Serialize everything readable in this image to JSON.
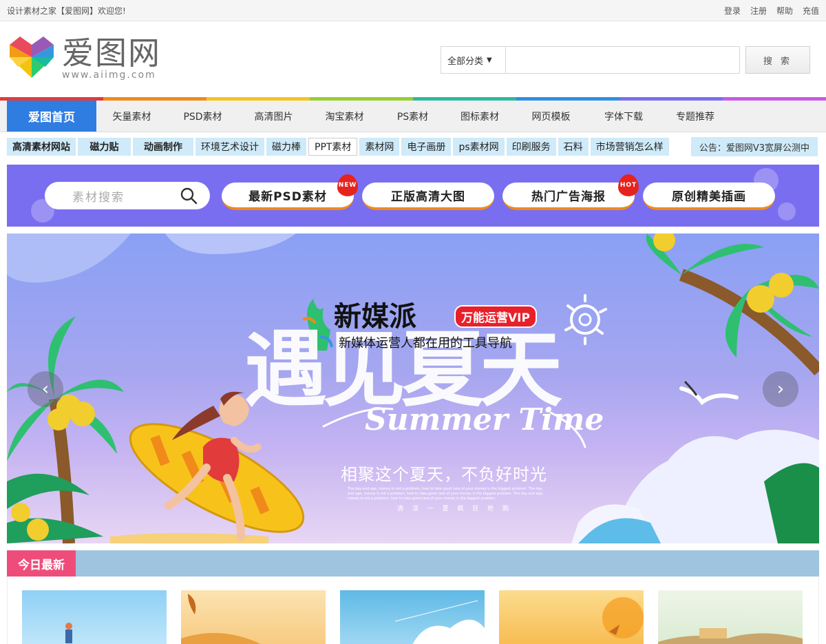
{
  "topbar": {
    "welcome": "设计素材之家【爱图网】欢迎您!",
    "links": [
      "登录",
      "注册",
      "帮助",
      "充值"
    ]
  },
  "logo": {
    "name": "爱图网",
    "domain": "www.aiimg.com"
  },
  "search": {
    "category": "全部分类",
    "placeholder": "",
    "button": "搜 索"
  },
  "rainbow": [
    "#e23b3b",
    "#f08a1a",
    "#f7c31b",
    "#9acd32",
    "#2db9a0",
    "#2f8fe0",
    "#7a6ef0",
    "#c75be0"
  ],
  "nav": {
    "home": "爱图首页",
    "items": [
      "矢量素材",
      "PSD素材",
      "高清图片",
      "淘宝素材",
      "PS素材",
      "图标素材",
      "网页模板",
      "字体下载",
      "专题推荐"
    ]
  },
  "tags": [
    "高清素材网站",
    "磁力贴",
    "动画制作",
    "环境艺术设计",
    "磁力棒",
    "PPT素材",
    "素材网",
    "电子画册",
    "ps素材网",
    "印刷服务",
    "石料",
    "市场营销怎么样"
  ],
  "notice": "公告：爱图网V3宽屏公测中",
  "quick": {
    "search_placeholder": "素材搜索",
    "pills": [
      "最新PSD素材",
      "正版高清大图",
      "热门广告海报",
      "原创精美插画"
    ],
    "badges": [
      "NEW",
      "HOT"
    ]
  },
  "hero": {
    "brand": "新媒派",
    "vip": "万能运营VIP",
    "subtitle": "新媒体运营人都在用的工具导航",
    "headline": "遇见夏天",
    "summer": "Summer Time",
    "slogan": "相聚这个夏天，不负好时光",
    "fine_print": "The day and age, money is not a problem, how to take good care of your money is the biggest problem. The day and age, money is not a problem, how to take good care of your money is the biggest problem. The day and age, money is not a problem, how to take good care of your money is the biggest problem.",
    "footer": "清 凉 一 夏    疯 狂 抢 购",
    "prev_icon": "‹",
    "next_icon": "›"
  },
  "today": {
    "label": "今日最新"
  }
}
